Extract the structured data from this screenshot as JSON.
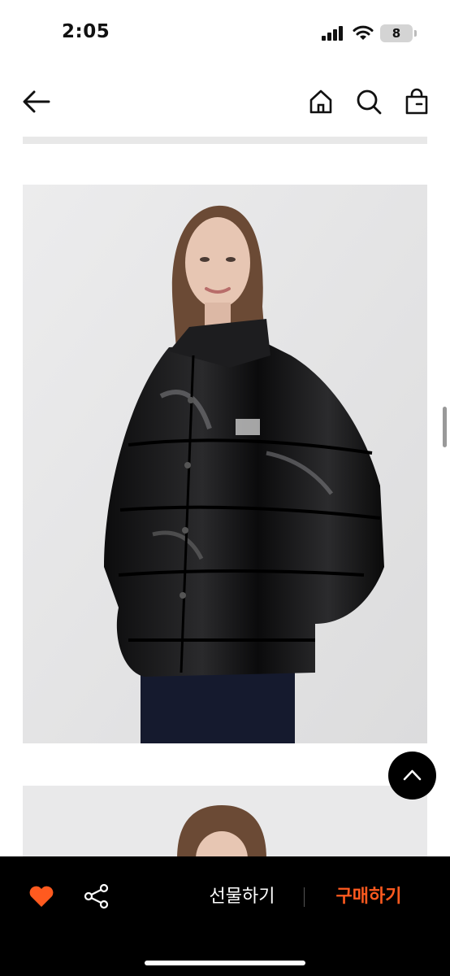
{
  "status_bar": {
    "time": "2:05",
    "battery_level": "8",
    "icons": [
      "cellular-signal-icon",
      "wifi-icon",
      "battery-icon"
    ]
  },
  "header": {
    "icons": [
      "back-arrow-icon",
      "home-icon",
      "search-icon",
      "shopping-bag-icon"
    ]
  },
  "product_images": [
    {
      "subject": "model wearing glossy black puffer jacket"
    },
    {
      "subject": "model photo partially visible"
    }
  ],
  "bottom_bar": {
    "gift_label": "선물하기",
    "buy_label": "구매하기",
    "liked": true,
    "icons": [
      "heart-icon",
      "share-icon"
    ]
  },
  "colors": {
    "accent": "#ff5a1f",
    "bar_background": "#000000"
  }
}
